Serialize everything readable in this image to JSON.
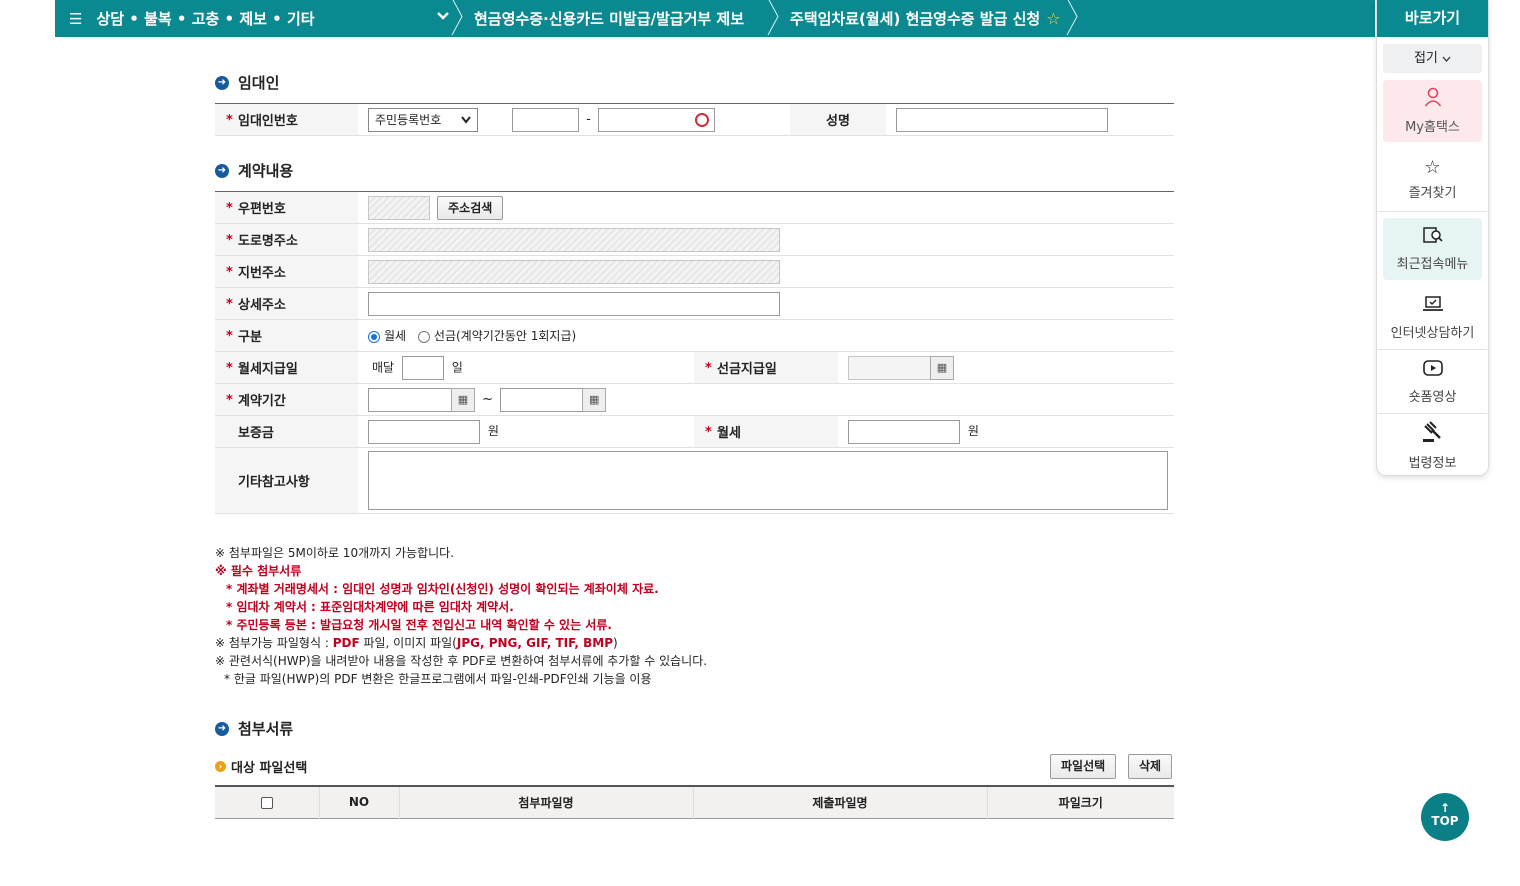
{
  "topbar": {
    "menu": "상담 • 불복 • 고충 • 제보 • 기타",
    "crumb1": "현금영수증·신용카드 미발급/발급거부 제보",
    "crumb2": "주택임차료(월세) 현금영수증 발급 신청"
  },
  "sections": {
    "landlord": "임대인",
    "contract": "계약내용",
    "attachments": "첨부서류"
  },
  "landlord": {
    "id_label": "임대인번호",
    "id_type": "주민등록번호",
    "dash": "-",
    "name_label": "성명"
  },
  "contract": {
    "zip_label": "우편번호",
    "addr_search": "주소검색",
    "road_label": "도로명주소",
    "jibun_label": "지번주소",
    "detail_label": "상세주소",
    "type_label": "구분",
    "type_opt1": "월세",
    "type_opt2": "선금(계약기간동안 1회지급)",
    "pay_day_label": "월세지급일",
    "monthly": "매달",
    "day": "일",
    "prepay_day_label": "선금지급일",
    "period_label": "계약기간",
    "tilde": "~",
    "deposit_label": "보증금",
    "won": "원",
    "rent_label": "월세",
    "etc_label": "기타참고사항"
  },
  "notes": {
    "n1": "※ 첨부파일은 5M이하로 10개까지 가능합니다.",
    "n2": "※ 필수 첨부서류",
    "n3": "* 계좌별 거래명세서 : 임대인 성명과 임차인(신청인) 성명이 확인되는 계좌이체 자료.",
    "n4": "* 임대차 계약서 : 표준임대차계약에 따른 임대차 계약서.",
    "n5": "* 주민등록 등본 : 발급요청 개시일 전후 전입신고 내역 확인할 수 있는 서류.",
    "n6a": "※ 첨부가능 파일형식 : ",
    "n6b": "PDF",
    "n6c": " 파일, 이미지 파일(",
    "n6d": "JPG, PNG, GIF, TIF, BMP",
    "n6e": ")",
    "n7": "※ 관련서식(HWP)을 내려받아 내용을 작성한 후 PDF로 변환하여 첨부서류에 추가할 수 있습니다.",
    "n8": "* 한글 파일(HWP)의 PDF 변환은 한글프로그램에서 파일-인쇄-PDF인쇄 기능을 이용"
  },
  "files": {
    "title": "대상 파일선택",
    "select_btn": "파일선택",
    "delete_btn": "삭제",
    "col_no": "NO",
    "col_attach": "첨부파일명",
    "col_submit": "제출파일명",
    "col_size": "파일크기"
  },
  "quick": {
    "title": "바로가기",
    "fold": "접기",
    "my": "My홈택스",
    "fav": "즐겨찾기",
    "recent": "최근접속메뉴",
    "consult": "인터넷상담하기",
    "video": "숏폼영상",
    "law": "법령정보"
  },
  "top_btn": "TOP"
}
